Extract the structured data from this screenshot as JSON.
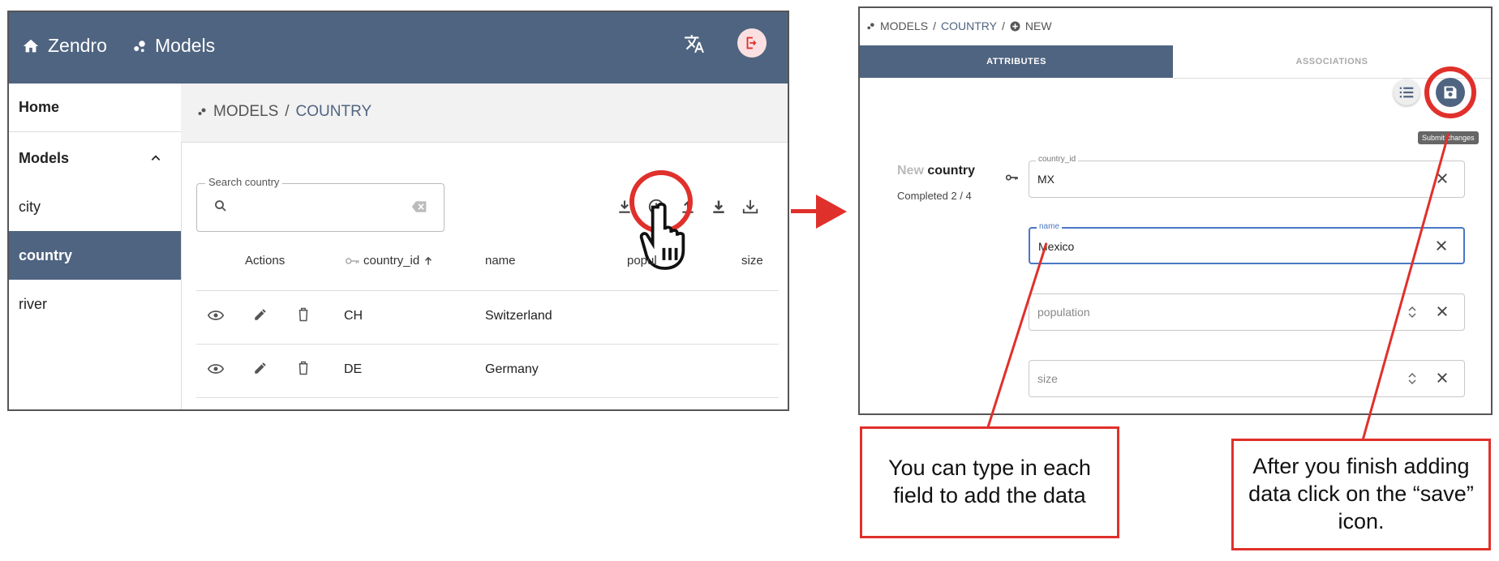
{
  "left": {
    "topbar": {
      "home_label": "Zendro",
      "models_label": "Models"
    },
    "sidebar": {
      "home": "Home",
      "models": "Models",
      "items": [
        "city",
        "country",
        "river"
      ]
    },
    "breadcrumb": {
      "root": "MODELS",
      "sep": "/",
      "current": "COUNTRY"
    },
    "search": {
      "legend": "Search country"
    },
    "table": {
      "headers": {
        "actions": "Actions",
        "country_id": "country_id",
        "name": "name",
        "population": "popul",
        "size": "size"
      },
      "rows": [
        {
          "country_id": "CH",
          "name": "Switzerland"
        },
        {
          "country_id": "DE",
          "name": "Germany"
        }
      ]
    }
  },
  "right": {
    "breadcrumb": {
      "root": "MODELS",
      "sep": "/",
      "model": "COUNTRY",
      "sep2": "/",
      "current": "NEW"
    },
    "tabs": {
      "attributes": "ATTRIBUTES",
      "associations": "ASSOCIATIONS"
    },
    "form": {
      "title_prefix": "New",
      "title_model": "country",
      "progress": "Completed 2 / 4",
      "tooltip": "Submit changes",
      "fields": [
        {
          "label": "country_id",
          "value": "MX"
        },
        {
          "label": "name",
          "value": "Mexico"
        },
        {
          "placeholder": "population"
        },
        {
          "placeholder": "size"
        }
      ]
    }
  },
  "callouts": {
    "type_hint": "You can type in each field to add the data",
    "save_hint": "After you finish adding data click on the “save” icon."
  },
  "colors": {
    "primary": "#4f6480",
    "annotation_red": "#e0302b"
  }
}
